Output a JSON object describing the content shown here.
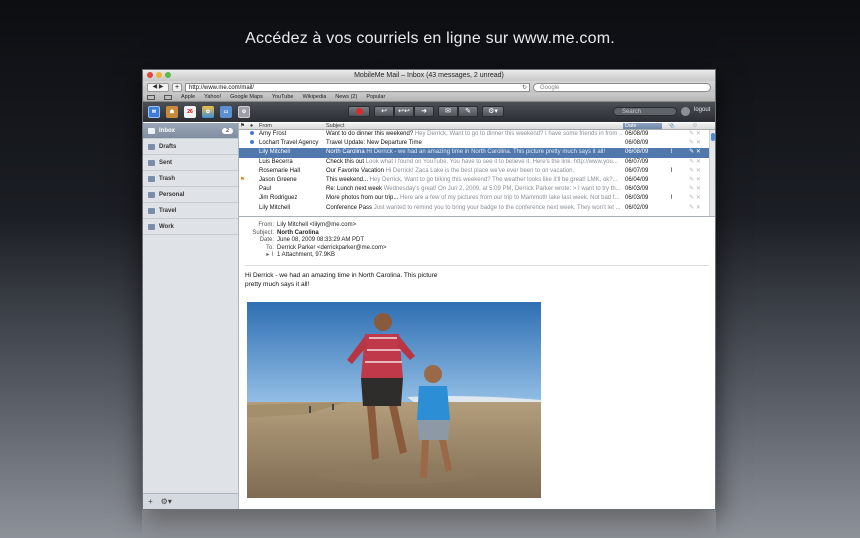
{
  "headline": "Accédez à vos courriels en ligne sur www.me.com.",
  "window": {
    "title": "MobileMe Mail – Inbox (43 messages, 2 unread)"
  },
  "browser": {
    "url": "http://www.me.com/mail/",
    "search_placeholder": "Google",
    "bookmarks": [
      "Apple",
      "Yahoo!",
      "Google Maps",
      "YouTube",
      "Wikipedia",
      "News (2)",
      "Popular"
    ]
  },
  "appbar": {
    "calendar_day": "26",
    "search_placeholder": "Search",
    "logout": "logout"
  },
  "folders": [
    {
      "label": "Inbox",
      "count": "2"
    },
    {
      "label": "Drafts"
    },
    {
      "label": "Sent"
    },
    {
      "label": "Trash"
    },
    {
      "label": "Personal"
    },
    {
      "label": "Travel"
    },
    {
      "label": "Work"
    }
  ],
  "list": {
    "columns": {
      "from": "From",
      "subject": "Subject",
      "date": "Date"
    },
    "rows": [
      {
        "from": "Amy Frost",
        "subject": "Want to do dinner this weekend?",
        "preview": "Hey Derrick, Want to go to dinner this weekend? I have some friends in from ...",
        "date": "06/08/09",
        "unread": true
      },
      {
        "from": "Lochart Travel Agency",
        "subject": "Travel Update: New Departure Time",
        "preview": "",
        "date": "06/08/09",
        "unread": true
      },
      {
        "from": "Lily Mitchell",
        "subject": "North Carolina",
        "preview": "Hi Derrick - we had an amazing time in North Carolina. This picture pretty much says it all!",
        "date": "06/08/09",
        "attachment": true
      },
      {
        "from": "Luis Becerra",
        "subject": "Check this out",
        "preview": "Look what I found on YouTube. You have to see it to believe it. Here's the link. http://www.you...",
        "date": "06/07/09"
      },
      {
        "from": "Rosemarie Hall",
        "subject": "Our Favorite Vacation",
        "preview": "Hi Derrick! Zaca Lake is the best place we've ever been to on vacation.",
        "date": "06/07/09",
        "attachment": true
      },
      {
        "from": "Jason Greene",
        "subject": "This weekend...",
        "preview": "Hey Derrick, Want to go biking this weekend? The weather looks like it'll be great! LMK, ok?...",
        "date": "06/04/09",
        "flagged": true
      },
      {
        "from": "Paul",
        "subject": "Re: Lunch next week",
        "preview": "Wednesday's great! On Jun 2, 2009, at 5:09 PM, Derrick Parker wrote: > I want to try th...",
        "date": "06/03/09"
      },
      {
        "from": "Jim Rodriguez",
        "subject": "More photos from our trip...",
        "preview": "Here are a few of my pictures from our trip to Mammoth lake last week. Not bad f...",
        "date": "06/03/09",
        "attachment": true
      },
      {
        "from": "Lily Mitchell",
        "subject": "Conference Pass",
        "preview": "Just wanted to remind you to bring your badge to the conference next week. They won't let ...",
        "date": "06/02/09"
      }
    ]
  },
  "message": {
    "labels": {
      "from": "From:",
      "subject": "Subject:",
      "date": "Date:",
      "to": "To:"
    },
    "from": "Lily Mitchell <lilym@me.com>",
    "subject": "North Carolina",
    "date": "June 08, 2009 08:33:29 AM PDT",
    "to": "Derrick Parker <derrickparker@me.com>",
    "attachment": "1 Attachment, 97.9KB",
    "body": "Hi Derrick - we had an amazing time in North Carolina.  This picture pretty much says it all!"
  }
}
